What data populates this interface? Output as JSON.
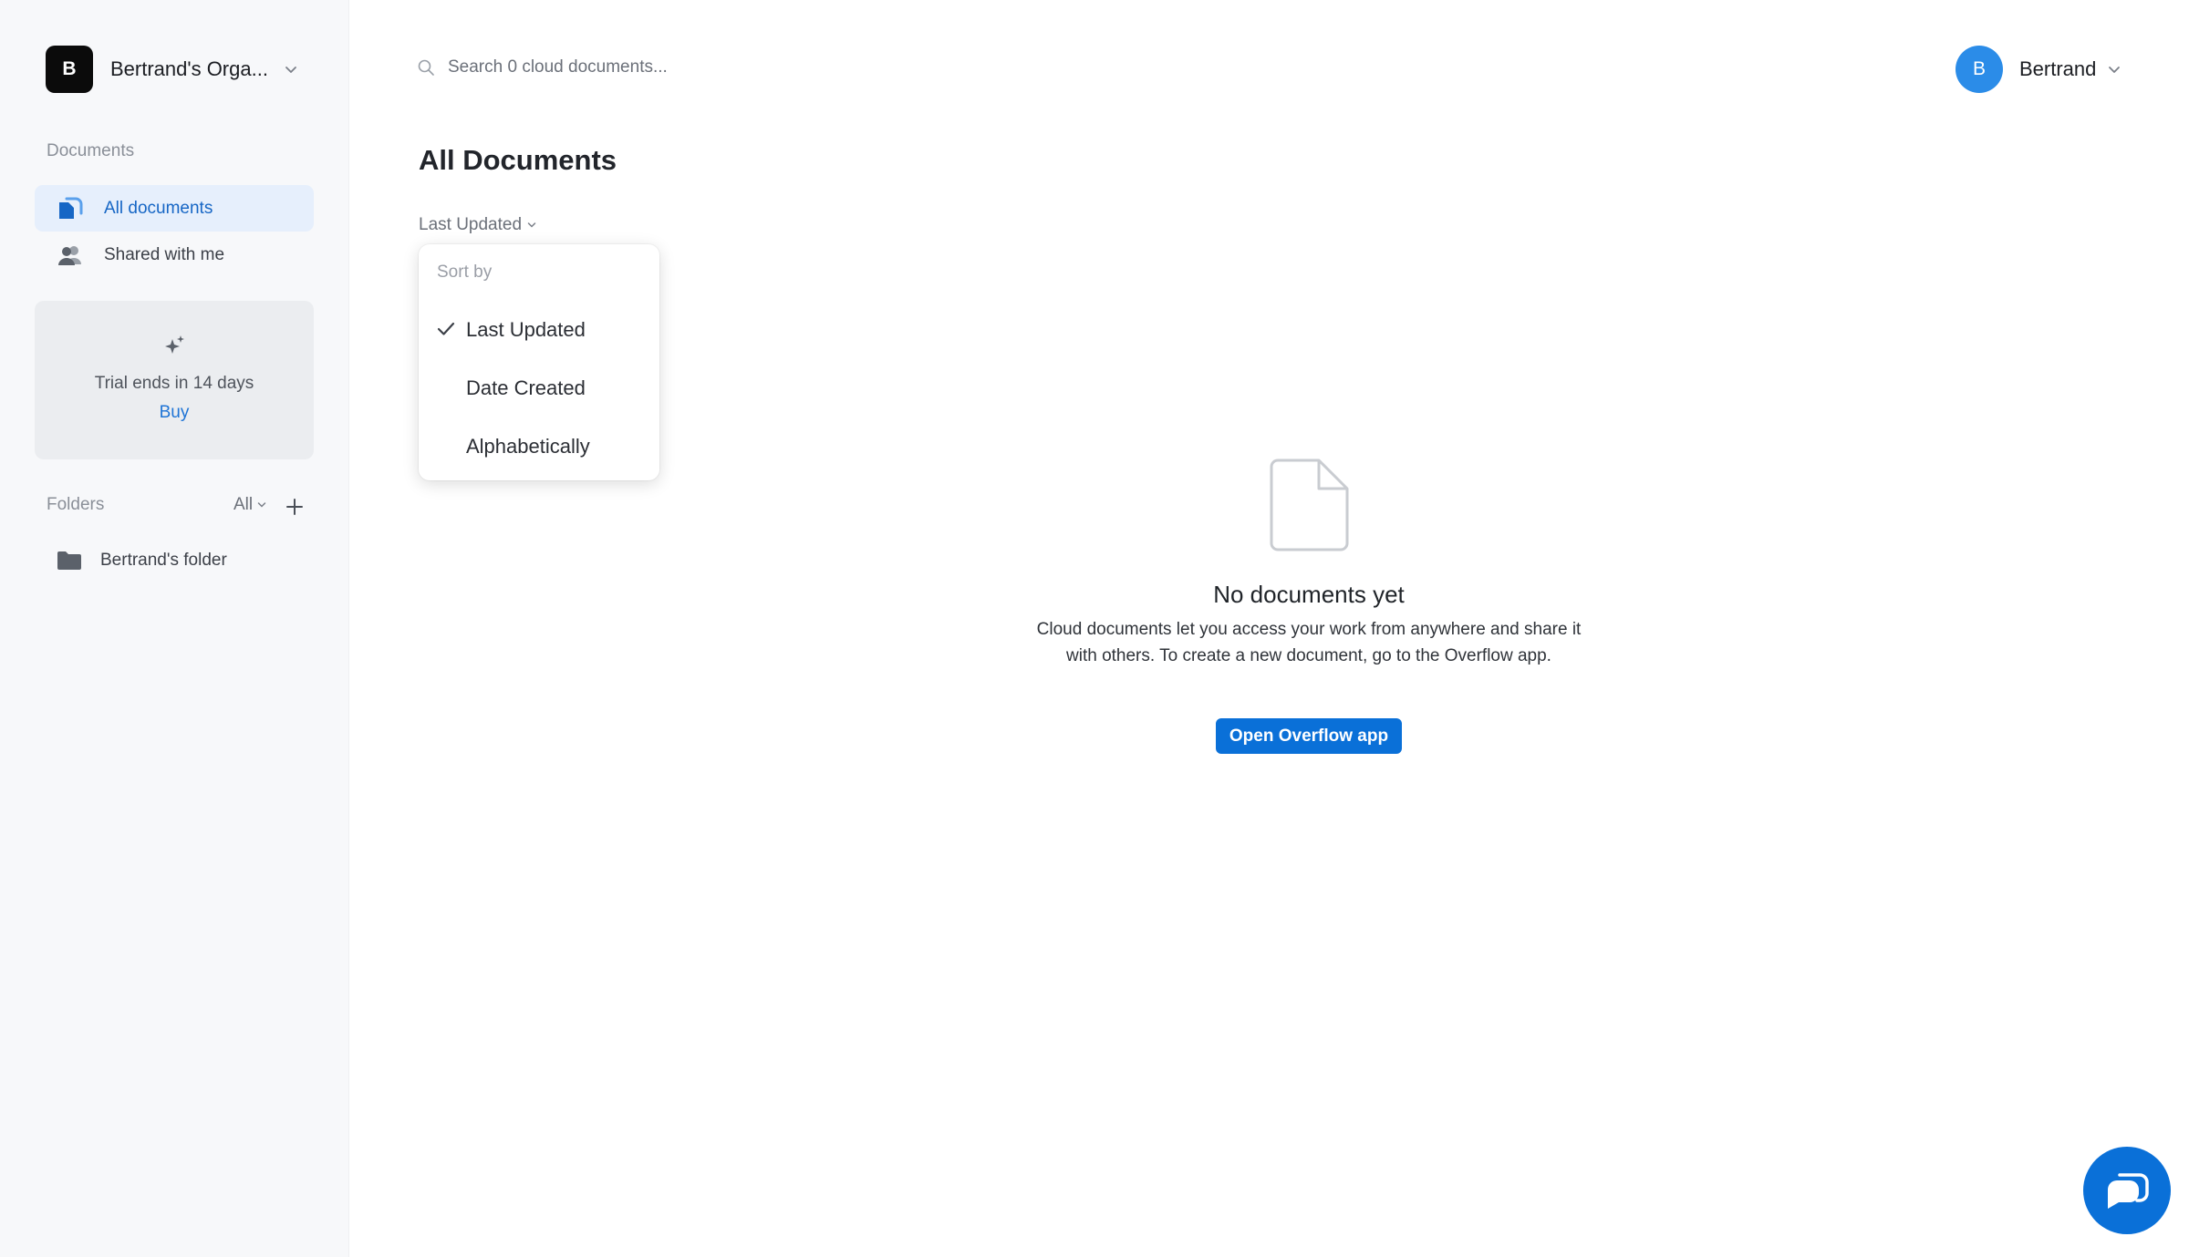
{
  "sidebar": {
    "org": {
      "initial": "B",
      "name": "Bertrand's Orga..."
    },
    "documents_title": "Documents",
    "nav": [
      {
        "label": "All documents",
        "active": true
      },
      {
        "label": "Shared with me",
        "active": false
      }
    ],
    "trial": {
      "text": "Trial ends in 14 days",
      "buy_label": "Buy"
    },
    "folders": {
      "title": "Folders",
      "filter_label": "All",
      "items": [
        {
          "label": "Bertrand's folder"
        }
      ]
    }
  },
  "header": {
    "search_placeholder": "Search 0 cloud documents...",
    "user": {
      "initial": "B",
      "name": "Bertrand"
    }
  },
  "main": {
    "title": "All Documents",
    "sort": {
      "current": "Last Updated",
      "menu_title": "Sort by",
      "options": [
        {
          "label": "Last Updated",
          "checked": true
        },
        {
          "label": "Date Created",
          "checked": false
        },
        {
          "label": "Alphabetically",
          "checked": false
        }
      ]
    },
    "empty": {
      "title": "No documents yet",
      "description": "Cloud documents let you access your work from anywhere and share it with others. To create a new document, go to the Overflow app.",
      "button_label": "Open Overflow app"
    }
  },
  "colors": {
    "accent": "#0a70d8",
    "active_nav_bg": "#e6effc",
    "sidebar_bg": "#f7f8fa",
    "avatar": "#2b8ce8"
  },
  "icons": [
    "chevron-down-icon",
    "documents-icon",
    "shared-users-icon",
    "sparkle-icon",
    "plus-icon",
    "folder-icon",
    "search-icon",
    "check-icon",
    "blank-document-icon",
    "chat-icon"
  ]
}
